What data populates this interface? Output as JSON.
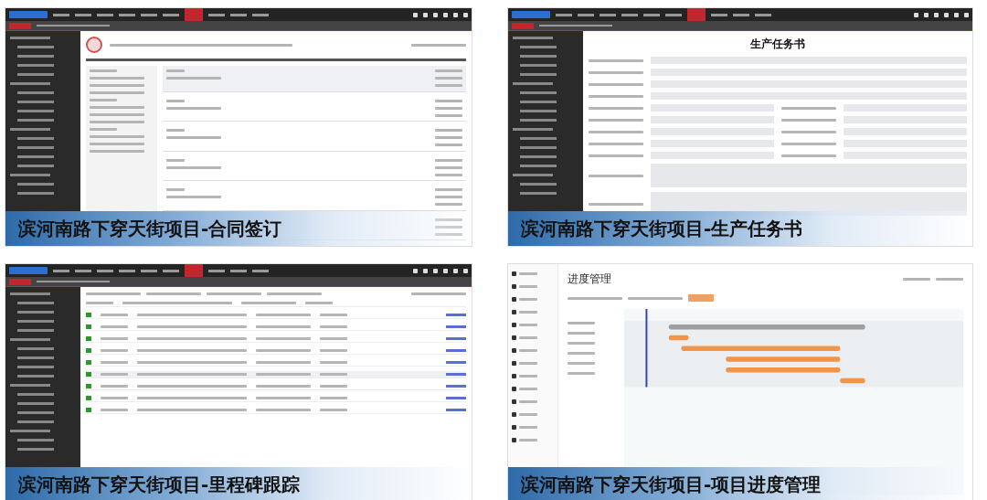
{
  "panels": [
    {
      "kind": "dashboard",
      "caption": "滨河南路下穿天街项目-合同签订"
    },
    {
      "kind": "form",
      "title": "生产任务书",
      "caption": "滨河南路下穿天街项目-生产任务书"
    },
    {
      "kind": "table",
      "caption": "滨河南路下穿天街项目-里程碑跟踪"
    },
    {
      "kind": "gantt",
      "title": "进度管理",
      "caption": "滨河南路下穿天街项目-项目进度管理"
    }
  ]
}
